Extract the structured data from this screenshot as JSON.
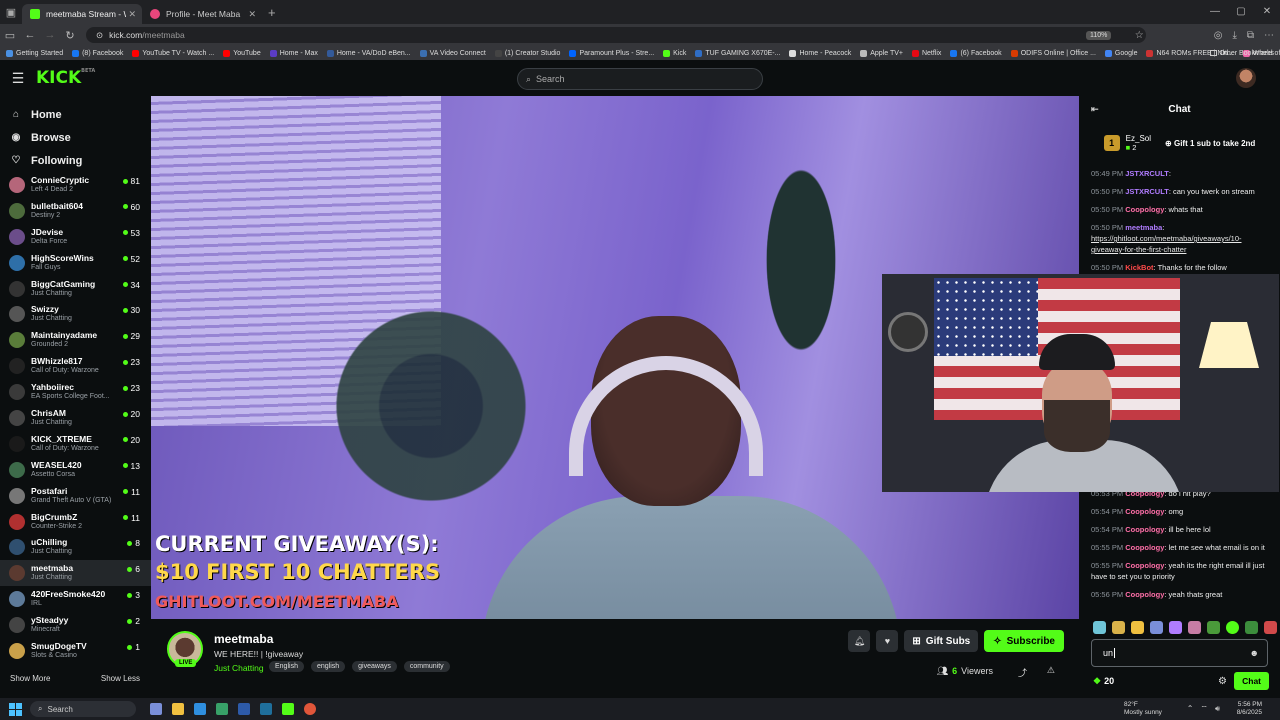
{
  "browser": {
    "tabs": [
      {
        "title": "meetmaba Stream - Watch Li",
        "active": true
      },
      {
        "title": "Profile - Meet Maba",
        "active": false
      }
    ],
    "url_host": "kick.com",
    "url_path": "/meetmaba",
    "zoom": "110%",
    "bookmarks": [
      "Getting Started",
      "(8) Facebook",
      "YouTube TV - Watch ...",
      "YouTube",
      "Home - Max",
      "Home - VA/DoD eBen...",
      "VA Video Connect",
      "(1) Creator Studio",
      "Paramount Plus - Stre...",
      "Kick",
      "TUF GAMING X670E-...",
      "Home - Peacock",
      "Apple TV+",
      "Netflix",
      "(6) Facebook",
      "ODIFS Online | Office ...",
      "Google",
      "N64 ROMs FREE | Nin...",
      "Wheel of Names | Ran...",
      "Eklipse"
    ],
    "other_bookmarks": "Other Bookmarks"
  },
  "header": {
    "logo": "KICK",
    "logo_sup": "BETA",
    "search_placeholder": "Search"
  },
  "sidebar": {
    "nav": [
      {
        "label": "Home",
        "icon": "home-icon"
      },
      {
        "label": "Browse",
        "icon": "compass-icon"
      },
      {
        "label": "Following",
        "icon": "heart-icon"
      }
    ],
    "channels": [
      {
        "name": "ConnieCryptic",
        "game": "Left 4 Dead 2",
        "viewers": "81",
        "color": "#b5667a"
      },
      {
        "name": "bulletbait604",
        "game": "Destiny 2",
        "viewers": "60",
        "color": "#4d6b3c"
      },
      {
        "name": "JDevise",
        "game": "Delta Force",
        "viewers": "53",
        "color": "#6b4d8a"
      },
      {
        "name": "HighScoreWins",
        "game": "Fall Guys",
        "viewers": "52",
        "color": "#2e6fa8"
      },
      {
        "name": "BiggCatGaming",
        "game": "Just Chatting",
        "viewers": "34",
        "color": "#333"
      },
      {
        "name": "Swizzy",
        "game": "Just Chatting",
        "viewers": "30",
        "color": "#555"
      },
      {
        "name": "Maintainyadame",
        "game": "Grounded 2",
        "viewers": "29",
        "color": "#5a7d3a"
      },
      {
        "name": "BWhizzle817",
        "game": "Call of Duty: Warzone",
        "viewers": "23",
        "color": "#222"
      },
      {
        "name": "Yahboiirec",
        "game": "EA Sports College Foot...",
        "viewers": "23",
        "color": "#3a3a3a"
      },
      {
        "name": "ChrisAM",
        "game": "Just Chatting",
        "viewers": "20",
        "color": "#444"
      },
      {
        "name": "KICK_XTREME",
        "game": "Call of Duty: Warzone",
        "viewers": "20",
        "color": "#1a1a1a"
      },
      {
        "name": "WEASEL420",
        "game": "Assetto Corsa",
        "viewers": "13",
        "color": "#3d6b4a"
      },
      {
        "name": "Postafari",
        "game": "Grand Theft Auto V (GTA)",
        "viewers": "11",
        "color": "#777"
      },
      {
        "name": "BigCrumbZ",
        "game": "Counter-Strike 2",
        "viewers": "11",
        "color": "#b03030"
      },
      {
        "name": "uChilling",
        "game": "Just Chatting",
        "viewers": "8",
        "color": "#2f4f6f"
      },
      {
        "name": "meetmaba",
        "game": "Just Chatting",
        "viewers": "6",
        "color": "#5b3a30"
      },
      {
        "name": "420FreeSmoke420",
        "game": "IRL",
        "viewers": "3",
        "color": "#5d7a99"
      },
      {
        "name": "ySteadyy",
        "game": "Minecraft",
        "viewers": "2",
        "color": "#444"
      },
      {
        "name": "SmugDogeTV",
        "game": "Slots & Casino",
        "viewers": "1",
        "color": "#c9a04a"
      }
    ],
    "show_more": "Show More",
    "show_less": "Show Less"
  },
  "video": {
    "overlay_line1": "CURRENT GIVEAWAY(S):",
    "overlay_line2": "$10 FIRST 10 CHATTERS",
    "overlay_line3": "GHITLOOT.COM/MEETMABA"
  },
  "stream": {
    "streamer": "meetmaba",
    "live_label": "LIVE",
    "title": "WE HERE!! | !giveaway",
    "category": "Just Chatting",
    "tags": [
      "English",
      "english",
      "giveaways",
      "community"
    ],
    "gift_label": "Gift Subs",
    "subscribe_label": "Subscribe",
    "viewers": "6",
    "viewers_label": "Viewers"
  },
  "chat": {
    "title": "Chat",
    "pinned": {
      "rank": "1",
      "user": "Ez_Sol",
      "count": "2",
      "text": "Gift 1 sub to take 2nd"
    },
    "messages": [
      {
        "time": "05:49 PM",
        "user": "JSTXRCULT",
        "text": "",
        "color": "#b07cff"
      },
      {
        "time": "05:50 PM",
        "user": "JSTXRCULT",
        "text": "can you twerk on stream",
        "color": "#b07cff"
      },
      {
        "time": "05:50 PM",
        "user": "Coopology",
        "text": "whats that",
        "color": "#ff6fa8"
      },
      {
        "time": "05:50 PM",
        "user": "meetmaba",
        "text": "https://ghitloot.com/meetmaba/giveaways/10-giveaway-for-the-first-chatter",
        "color": "#b07cff"
      },
      {
        "time": "05:50 PM",
        "user": "KickBot",
        "text": "Thanks for the follow",
        "color": "#ff4a4a"
      }
    ],
    "messages_lower": [
      {
        "time": "05:53 PM",
        "user": "Coopology",
        "text": "do i hit play?",
        "color": "#ff6fa8"
      },
      {
        "time": "05:54 PM",
        "user": "Coopology",
        "text": "omg",
        "color": "#ff6fa8"
      },
      {
        "time": "05:54 PM",
        "user": "Coopology",
        "text": "ill be here lol",
        "color": "#ff6fa8"
      },
      {
        "time": "05:55 PM",
        "user": "Coopology",
        "text": "let me see what email is on it",
        "color": "#ff6fa8"
      },
      {
        "time": "05:55 PM",
        "user": "Coopology",
        "text": "yeah its the right email ill just have to set you to priority",
        "color": "#ff6fa8"
      },
      {
        "time": "05:56 PM",
        "user": "Coopology",
        "text": "yeah thats great",
        "color": "#ff6fa8"
      }
    ],
    "input_value": "un",
    "points": "20",
    "send_label": "Chat"
  },
  "taskbar": {
    "search_placeholder": "Search",
    "weather_temp": "82°F",
    "weather_desc": "Mostly sunny",
    "time": "5:56 PM",
    "date": "8/6/2025"
  }
}
